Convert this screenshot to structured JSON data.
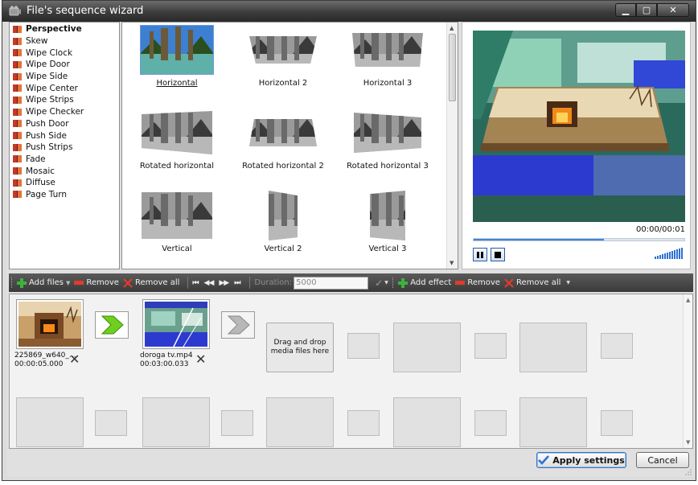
{
  "window": {
    "title": "File's sequence wizard",
    "minimize_glyph": "▁",
    "maximize_glyph": "▢",
    "close_glyph": "✕"
  },
  "effects": {
    "items": [
      {
        "label": "Perspective",
        "selected": true
      },
      {
        "label": "Skew"
      },
      {
        "label": "Wipe Clock"
      },
      {
        "label": "Wipe Door"
      },
      {
        "label": "Wipe Side"
      },
      {
        "label": "Wipe Center"
      },
      {
        "label": "Wipe Strips"
      },
      {
        "label": "Wipe Checker"
      },
      {
        "label": "Push Door"
      },
      {
        "label": "Push Side"
      },
      {
        "label": "Push Strips"
      },
      {
        "label": "Fade"
      },
      {
        "label": "Mosaic"
      },
      {
        "label": "Diffuse"
      },
      {
        "label": "Page Turn"
      }
    ]
  },
  "thumbnails": {
    "items": [
      {
        "label": "Horizontal",
        "selected": true
      },
      {
        "label": "Horizontal 2"
      },
      {
        "label": "Horizontal 3"
      },
      {
        "label": "Rotated horizontal"
      },
      {
        "label": "Rotated horizontal 2"
      },
      {
        "label": "Rotated horizontal 3"
      },
      {
        "label": "Vertical"
      },
      {
        "label": "Vertical 2"
      },
      {
        "label": "Vertical 3"
      }
    ]
  },
  "preview": {
    "time": "00:00/00:01",
    "progress_fraction": 0.62
  },
  "toolbar": {
    "add_files": "Add files",
    "remove": "Remove",
    "remove_all": "Remove all",
    "duration_label": "Duration:",
    "duration_value": "5000",
    "add_effect": "Add effect",
    "remove_effect": "Remove",
    "remove_all_effects": "Remove all",
    "nav_first": "⏮",
    "nav_prev": "◀◀",
    "nav_next": "▶▶",
    "nav_last": "⏭"
  },
  "timeline": {
    "clips": [
      {
        "name": "225869_w640_...",
        "duration": "00:00:05.000"
      },
      {
        "name": "doroga tv.mp4",
        "duration": "00:03:00.033"
      }
    ],
    "drop_text_line1": "Drag and drop",
    "drop_text_line2": "media files here",
    "remove_glyph": "✕"
  },
  "buttons": {
    "apply": "Apply settings",
    "cancel": "Cancel"
  },
  "colors": {
    "accent_blue": "#2d6fd6",
    "transition_green": "#6fcf1f",
    "remove_red": "#e03c2a",
    "add_green": "#3db33d"
  }
}
